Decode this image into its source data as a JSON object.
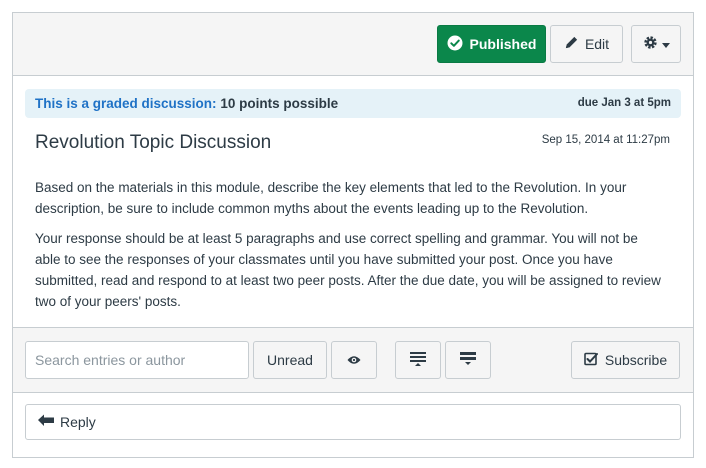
{
  "header": {
    "published_label": "Published",
    "edit_label": "Edit"
  },
  "graded": {
    "label": "This is a graded discussion:",
    "points": "10 points possible",
    "due": "due Jan 3 at 5pm"
  },
  "topic": {
    "title": "Revolution Topic Discussion",
    "date": "Sep 15, 2014 at 11:27pm",
    "paragraphs": [
      "Based on the materials in this module, describe the key elements that led to the Revolution. In your description, be sure to include common myths about the events leading up to the Revolution.",
      "Your response should be at least 5 paragraphs and use correct spelling and grammar. You will not be able to see the responses of your classmates until you have submitted your post. Once you have submitted, read and respond to at least two peer posts. After the due date, you will be assigned to review two of your peers' posts."
    ]
  },
  "toolbar": {
    "search_placeholder": "Search entries or author",
    "unread_label": "Unread",
    "subscribe_label": "Subscribe"
  },
  "reply": {
    "label": "Reply"
  },
  "colors": {
    "published_green": "#0b874b",
    "graded_banner_bg": "#e5f2f8",
    "graded_label_blue": "#1f72c6"
  },
  "icons": {
    "published": "check-circle-icon",
    "edit": "pencil-icon",
    "settings": "gear-icon",
    "settings_caret": "caret-down-icon",
    "eye": "eye-icon",
    "collapse": "collapse-threads-icon",
    "expand": "expand-threads-icon",
    "subscribe": "checkbox-icon",
    "reply": "reply-arrow-icon"
  }
}
